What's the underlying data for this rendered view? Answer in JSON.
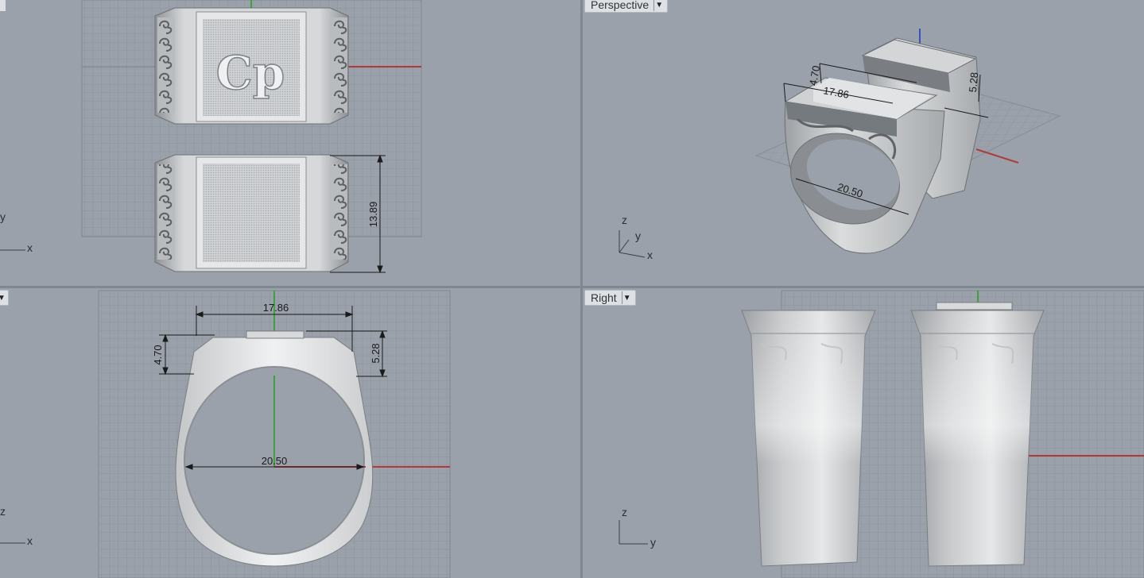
{
  "viewports": {
    "top": {
      "axis_x": "x",
      "axis_y": "y",
      "dimension": "13.89"
    },
    "perspective": {
      "label": "Perspective",
      "axis_z": "z",
      "axis_y": "y",
      "axis_x": "x",
      "dims": [
        "4.70",
        "17.86",
        "5.28",
        "20.50"
      ]
    },
    "front": {
      "axis_z": "z",
      "axis_x": "x",
      "dim_width": "17.86",
      "dim_left": "4.70",
      "dim_right": "5.28",
      "dim_inner": "20.50"
    },
    "right": {
      "label": "Right",
      "axis_z": "z",
      "axis_y": "y"
    }
  },
  "engraving": "Cp",
  "colors": {
    "viewport_bg": "#9aa1aa",
    "grid": "#8a919a",
    "x_axis": "#b03a3a",
    "y_axis": "#3aa33a",
    "metal": "#d9dbdd"
  }
}
